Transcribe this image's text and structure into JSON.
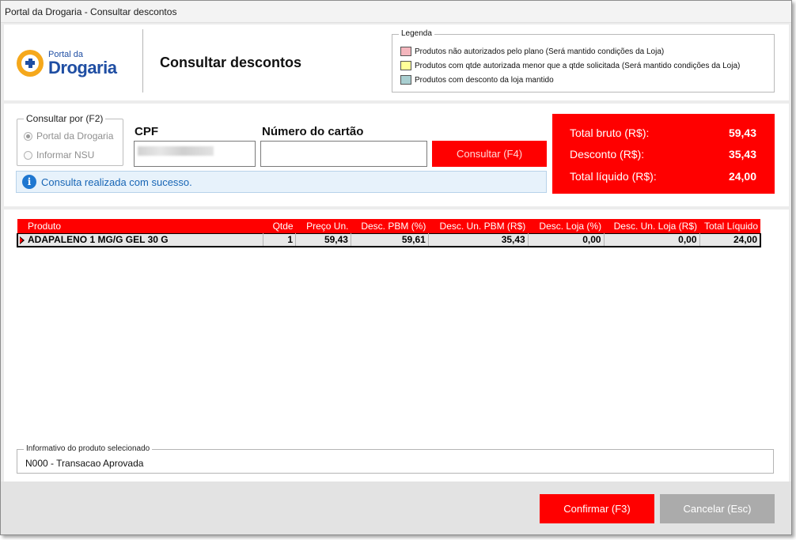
{
  "window": {
    "title": "Portal da Drogaria - Consultar descontos"
  },
  "header": {
    "logo_small": "Portal da",
    "logo_big": "Drogaria",
    "page_title": "Consultar descontos",
    "legend": {
      "title": "Legenda",
      "items": [
        {
          "label": "Produtos não autorizados pelo plano (Será mantido condições da Loja)",
          "color": "#f4b6bd"
        },
        {
          "label": "Produtos com qtde autorizada menor que a qtde solicitada (Será mantido condições da Loja)",
          "color": "#ffff99"
        },
        {
          "label": "Produtos com desconto da loja mantido",
          "color": "#a9cfd1"
        }
      ]
    }
  },
  "filter": {
    "group_title": "Consultar por (F2)",
    "options": [
      "Portal da Drogaria",
      "Informar NSU"
    ],
    "cpf_label": "CPF",
    "card_label": "Número do cartão",
    "card_value": "",
    "consult_button": "Consultar (F4)",
    "info_message": "Consulta realizada com sucesso."
  },
  "totals": {
    "bruto_label": "Total bruto (R$):",
    "bruto_value": "59,43",
    "desconto_label": "Desconto (R$):",
    "desconto_value": "35,43",
    "liquido_label": "Total líquido (R$):",
    "liquido_value": "24,00"
  },
  "grid": {
    "columns": [
      "Produto",
      "Qtde",
      "Preço Un.",
      "Desc. PBM (%)",
      "Desc. Un. PBM (R$)",
      "Desc. Loja (%)",
      "Desc. Un. Loja (R$)",
      "Total Líquido"
    ],
    "rows": [
      [
        "ADAPALENO 1 MG/G GEL 30 G",
        "1",
        "59,43",
        "59,61",
        "35,43",
        "0,00",
        "0,00",
        "24,00"
      ]
    ]
  },
  "product_info": {
    "title": "Informativo do produto selecionado",
    "text": "N000 - Transacao Aprovada"
  },
  "footer": {
    "confirm": "Confirmar (F3)",
    "cancel": "Cancelar (Esc)"
  },
  "colors": {
    "accent": "#ff0000",
    "info_text": "#1765b5",
    "brand": "#1f4ea3",
    "logo_orange": "#f5a81c"
  }
}
